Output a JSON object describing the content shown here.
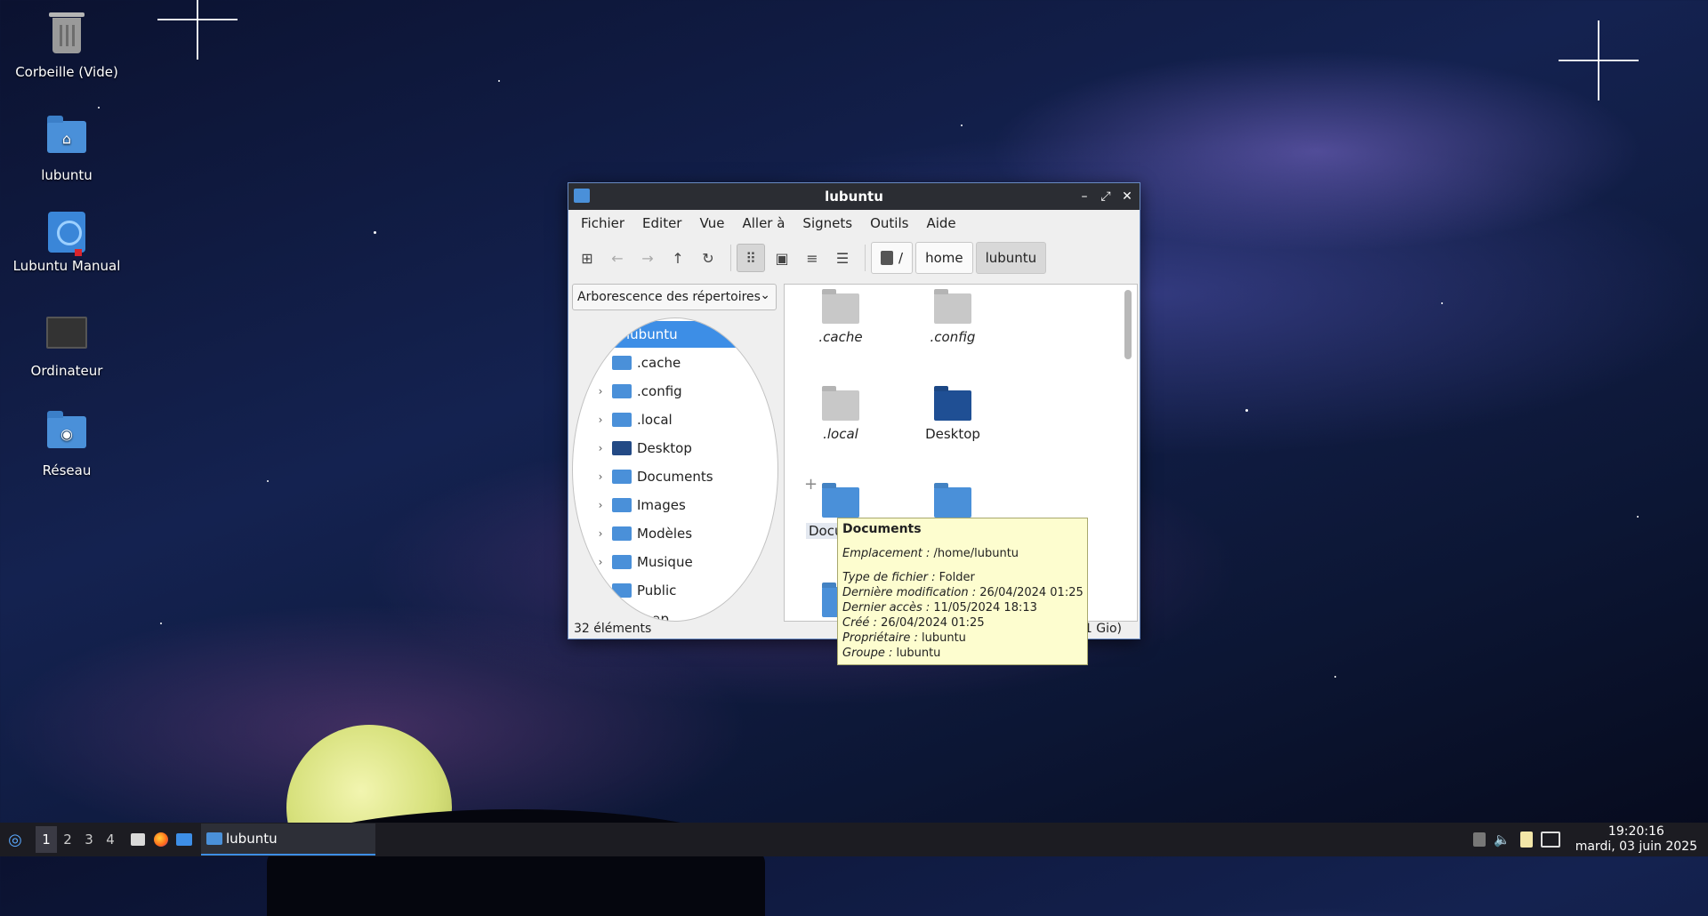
{
  "desktop": {
    "icons": [
      {
        "label": "Corbeille (Vide)",
        "icon": "trash-icon"
      },
      {
        "label": "lubuntu",
        "icon": "home-folder-icon"
      },
      {
        "label": "Lubuntu Manual",
        "icon": "manual-book-icon"
      },
      {
        "label": "Ordinateur",
        "icon": "computer-icon"
      },
      {
        "label": "Réseau",
        "icon": "network-folder-icon"
      }
    ]
  },
  "window": {
    "title": "lubuntu",
    "menu": [
      "Fichier",
      "Editer",
      "Vue",
      "Aller à",
      "Signets",
      "Outils",
      "Aide"
    ],
    "breadcrumb": [
      "/",
      "home",
      "lubuntu"
    ],
    "side_panel": {
      "selector": "Arborescence des répertoires",
      "tree": [
        {
          "label": "lubuntu",
          "selected": true
        },
        {
          "label": ".cache"
        },
        {
          "label": ".config"
        },
        {
          "label": ".local"
        },
        {
          "label": "Desktop"
        },
        {
          "label": "Documents"
        },
        {
          "label": "Images"
        },
        {
          "label": "Modèles"
        },
        {
          "label": "Musique"
        },
        {
          "label": "Public"
        },
        {
          "label": "snap"
        }
      ]
    },
    "content": {
      "items": [
        {
          "label": ".cache",
          "hidden": true
        },
        {
          "label": ".config",
          "hidden": true
        },
        {
          "label": ".local",
          "hidden": true
        },
        {
          "label": "Desktop",
          "hidden": false
        },
        {
          "label": "Docu",
          "hidden": false
        },
        {
          "label": "",
          "hidden": false
        }
      ]
    },
    "status": {
      "count": "32 éléments",
      "right": "1 Gio)"
    }
  },
  "tooltip": {
    "title": "Documents",
    "emplacement_k": "Emplacement :",
    "emplacement_v": " /home/lubuntu",
    "type_k": "Type de fichier :",
    "type_v": " Folder",
    "mod_k": "Dernière modification :",
    "mod_v": " 26/04/2024 01:25",
    "acc_k": "Dernier accès :",
    "acc_v": " 11/05/2024 18:13",
    "cree_k": "Créé :",
    "cree_v": " 26/04/2024 01:25",
    "prop_k": "Propriétaire :",
    "prop_v": " lubuntu",
    "grp_k": "Groupe :",
    "grp_v": " lubuntu"
  },
  "taskbar": {
    "workspaces": [
      "1",
      "2",
      "3",
      "4"
    ],
    "active_window": "lubuntu",
    "time": "19:20:16",
    "date": "mardi, 03 juin 2025"
  },
  "colors": {
    "accent": "#3d8ee6",
    "folder": "#4a90d9",
    "tooltip_bg": "#fdfdcf"
  }
}
